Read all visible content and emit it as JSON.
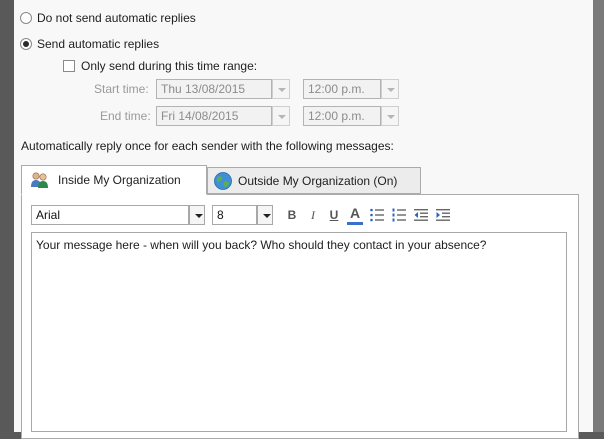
{
  "options": {
    "no_replies_label": "Do not send automatic replies",
    "send_replies_label": "Send automatic replies",
    "time_range_label": "Only send during this time range:"
  },
  "time_range": {
    "start_label": "Start time:",
    "start_date": "Thu 13/08/2015",
    "start_time": "12:00 p.m.",
    "end_label": "End time:",
    "end_date": "Fri 14/08/2015",
    "end_time": "12:00 p.m."
  },
  "reply_heading": "Automatically reply once for each sender with the following messages:",
  "tabs": [
    {
      "label": "Inside My Organization",
      "icon": "people-icon",
      "active": true
    },
    {
      "label": "Outside My Organization (On)",
      "icon": "globe-icon",
      "active": false
    }
  ],
  "format_bar": {
    "font": "Arial",
    "size": "8",
    "bold": "B",
    "italic": "I",
    "underline": "U",
    "font_color": "A"
  },
  "message": "Your message here - when will you back? Who should they contact in your absence?",
  "colors": {
    "accent_blue": "#2b65c1",
    "font_color_bar": "#3a6fd0"
  }
}
